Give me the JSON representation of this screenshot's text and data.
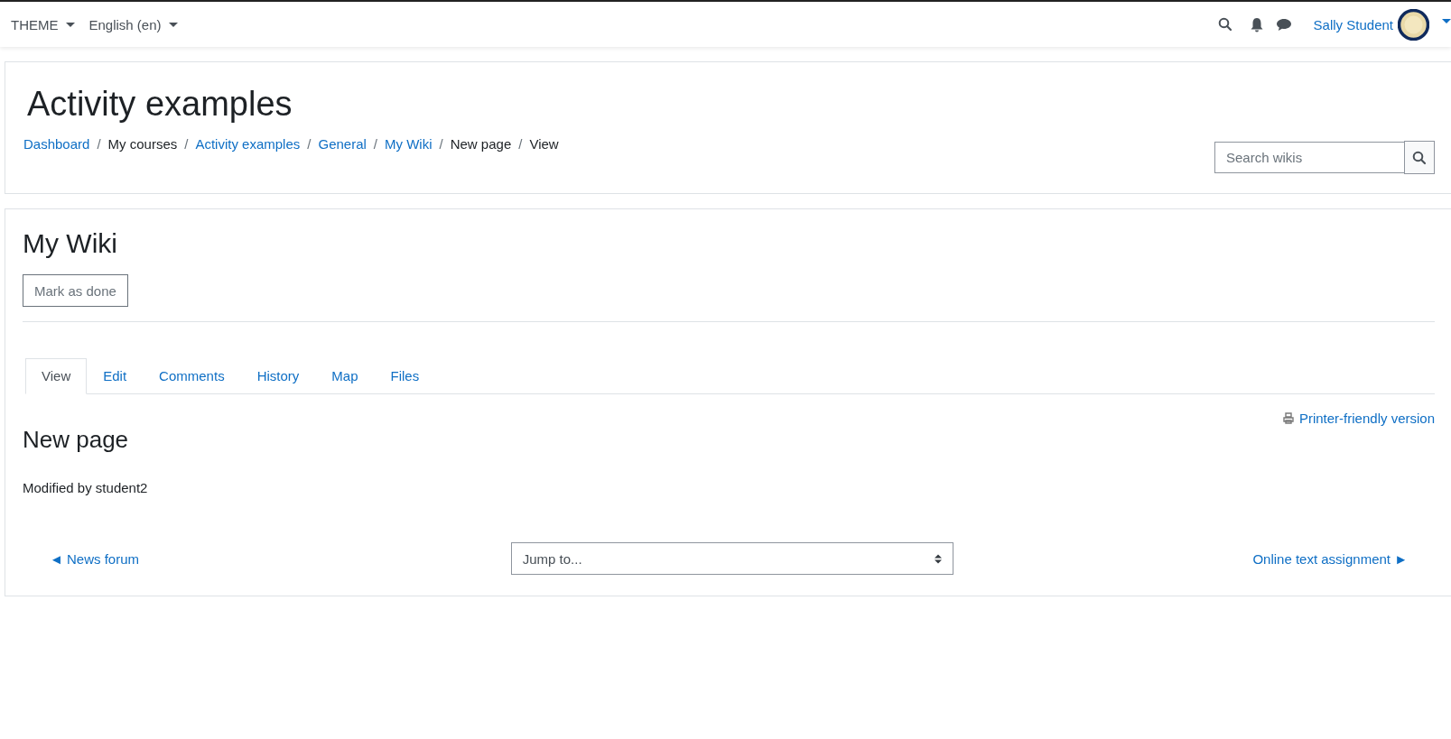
{
  "navbar": {
    "menus": [
      {
        "label": "THEME"
      },
      {
        "label": "English (en)"
      }
    ],
    "user": {
      "name": "Sally Student"
    }
  },
  "header": {
    "title": "Activity examples",
    "breadcrumb": [
      {
        "label": "Dashboard",
        "kind": "link"
      },
      {
        "separator": "/",
        "label": "My courses",
        "kind": "text"
      },
      {
        "separator": "/",
        "label": "Activity examples",
        "kind": "link"
      },
      {
        "separator": "/",
        "label": "General",
        "kind": "link"
      },
      {
        "separator": "/",
        "label": "My Wiki",
        "kind": "link"
      },
      {
        "separator": "/",
        "label": "New page",
        "kind": "text"
      },
      {
        "separator": "/",
        "label": "View",
        "kind": "text"
      }
    ],
    "search": {
      "placeholder": "Search wikis"
    }
  },
  "main": {
    "title": "My Wiki",
    "completion_button": "Mark as done",
    "tabs": [
      {
        "label": "View",
        "selected": true
      },
      {
        "label": "Edit",
        "selected": false
      },
      {
        "label": "Comments",
        "selected": false
      },
      {
        "label": "History",
        "selected": false
      },
      {
        "label": "Map",
        "selected": false
      },
      {
        "label": "Files",
        "selected": false
      }
    ],
    "printer_link": "Printer-friendly version",
    "page_title": "New page",
    "modified": "Modified by student2",
    "footer_nav": {
      "previous": "◄ News forum",
      "jump": {
        "placeholder": "Jump to..."
      },
      "next": "Online text assignment ►"
    }
  }
}
